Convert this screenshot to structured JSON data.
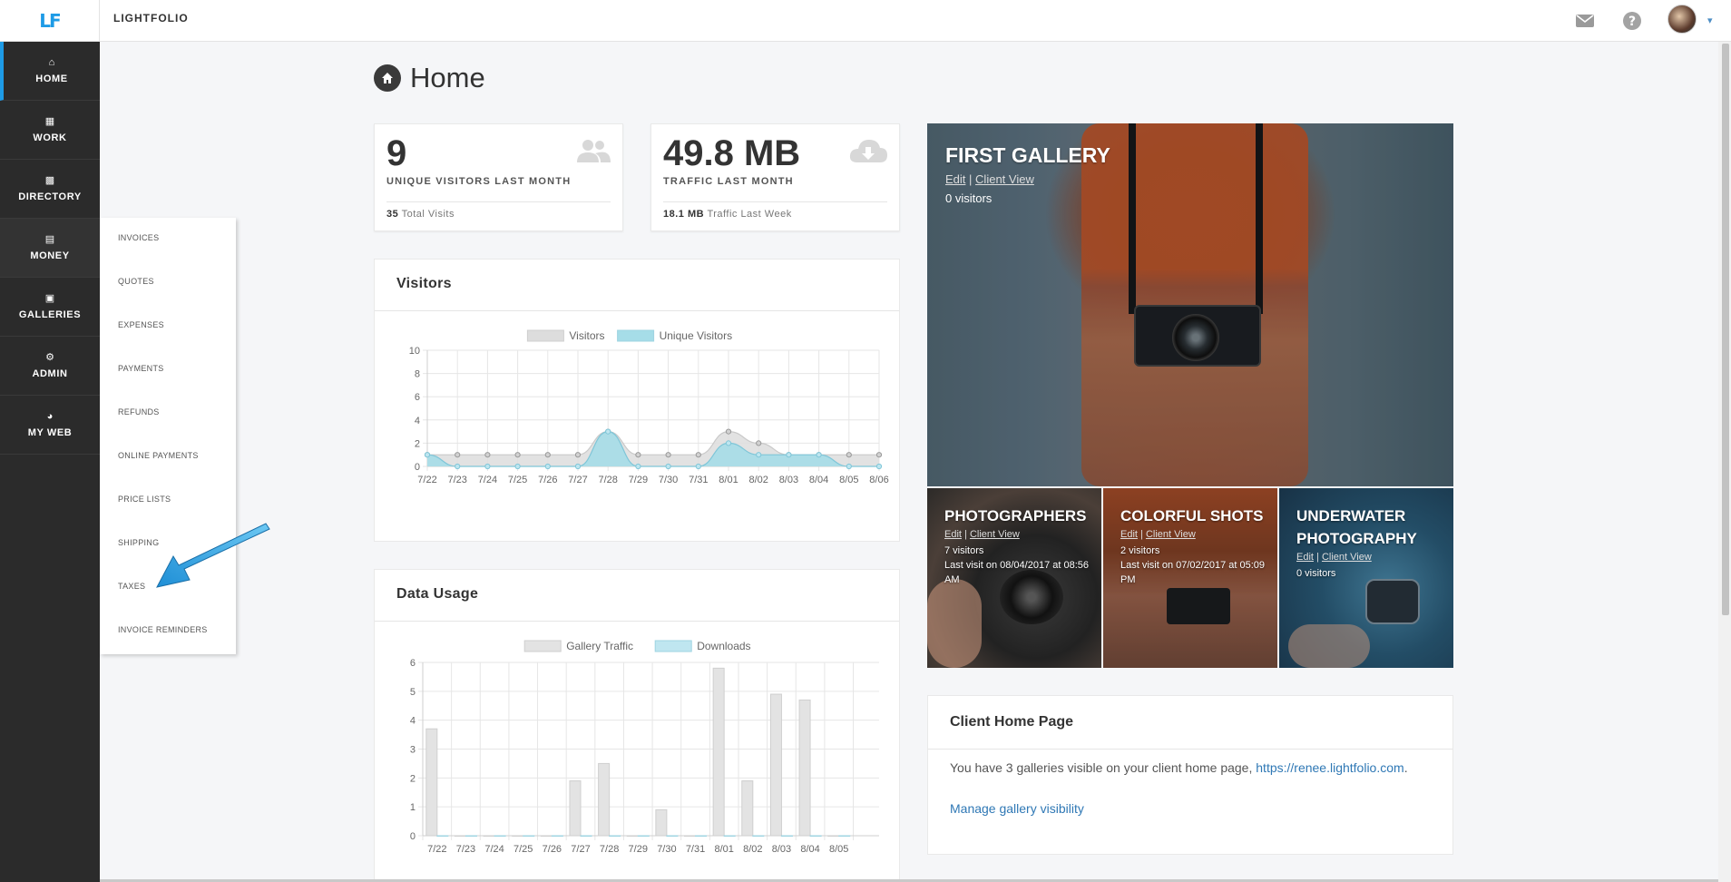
{
  "header": {
    "logo": "LF",
    "app_title": "LIGHTFOLIO",
    "icons": [
      "mail-icon",
      "help-icon",
      "avatar",
      "chevron-down-icon"
    ]
  },
  "sidebar": {
    "items": [
      {
        "label": "HOME",
        "icon": "home-icon",
        "active": true
      },
      {
        "label": "WORK",
        "icon": "calendar-icon"
      },
      {
        "label": "DIRECTORY",
        "icon": "directory-icon"
      },
      {
        "label": "MONEY",
        "icon": "money-icon"
      },
      {
        "label": "GALLERIES",
        "icon": "image-icon"
      },
      {
        "label": "ADMIN",
        "icon": "gear-icon"
      },
      {
        "label": "MY WEB",
        "icon": "globe-icon"
      }
    ]
  },
  "money_menu": {
    "items": [
      "INVOICES",
      "QUOTES",
      "EXPENSES",
      "PAYMENTS",
      "REFUNDS",
      "ONLINE PAYMENTS",
      "PRICE LISTS",
      "SHIPPING",
      "TAXES",
      "INVOICE REMINDERS"
    ]
  },
  "page": {
    "title": "Home"
  },
  "stats": [
    {
      "value": "9",
      "label": "UNIQUE VISITORS LAST MONTH",
      "foot_value": "35",
      "foot_text": "Total Visits",
      "icon": "users-icon"
    },
    {
      "value": "49.8 MB",
      "label": "TRAFFIC LAST MONTH",
      "foot_value": "18.1 MB",
      "foot_text": "Traffic Last Week",
      "icon": "cloud-download-icon"
    }
  ],
  "visitors_panel": {
    "title": "Visitors"
  },
  "data_usage_panel": {
    "title": "Data Usage"
  },
  "chart_data": [
    {
      "type": "area",
      "title": "Visitors",
      "categories": [
        "7/22",
        "7/23",
        "7/24",
        "7/25",
        "7/26",
        "7/27",
        "7/28",
        "7/29",
        "7/30",
        "7/31",
        "8/01",
        "8/02",
        "8/03",
        "8/04",
        "8/05",
        "8/06"
      ],
      "series": [
        {
          "name": "Visitors",
          "values": [
            1,
            1,
            1,
            1,
            1,
            1,
            3,
            1,
            1,
            1,
            3,
            2,
            1,
            1,
            1,
            1
          ],
          "color": "#dddddd"
        },
        {
          "name": "Unique Visitors",
          "values": [
            1,
            0,
            0,
            0,
            0,
            0,
            3,
            0,
            0,
            0,
            2,
            1,
            1,
            1,
            0,
            0
          ],
          "color": "#a6dde8"
        }
      ],
      "ylim": [
        0,
        10
      ],
      "yticks": [
        0,
        2,
        4,
        6,
        8,
        10
      ],
      "legend": "top",
      "grid": true
    },
    {
      "type": "bar",
      "title": "Data Usage",
      "categories": [
        "7/22",
        "7/23",
        "7/24",
        "7/25",
        "7/26",
        "7/27",
        "7/28",
        "7/29",
        "7/30",
        "7/31",
        "8/01",
        "8/02",
        "8/03",
        "8/04",
        "8/05"
      ],
      "series": [
        {
          "name": "Gallery Traffic",
          "values": [
            3.7,
            0,
            0,
            0,
            0,
            1.9,
            2.5,
            0,
            0.9,
            0,
            5.8,
            1.9,
            4.9,
            4.7,
            0
          ],
          "color": "#e3e3e3"
        },
        {
          "name": "Downloads",
          "values": [
            0,
            0,
            0,
            0,
            0,
            0,
            0,
            0,
            0,
            0,
            0,
            0,
            0,
            0,
            0
          ],
          "color": "#bfe6f0"
        }
      ],
      "ylim": [
        0,
        6
      ],
      "yticks": [
        0,
        1,
        2,
        3,
        4,
        5,
        6
      ],
      "legend": "top",
      "grid": true
    }
  ],
  "galleries": {
    "featured": {
      "title": "FIRST GALLERY",
      "edit": "Edit",
      "sep": "|",
      "client_view": "Client View",
      "visitors": "0 visitors"
    },
    "others": [
      {
        "title": "PHOTOGRAPHERS",
        "edit": "Edit",
        "sep": "|",
        "client_view": "Client View",
        "visitors": "7 visitors",
        "last_visit": "Last visit on 08/04/2017 at 08:56 AM"
      },
      {
        "title": "COLORFUL SHOTS",
        "edit": "Edit",
        "sep": "|",
        "client_view": "Client View",
        "visitors": "2 visitors",
        "last_visit": "Last visit on 07/02/2017 at 05:09 PM"
      },
      {
        "title": "UNDERWATER PHOTOGRAPHY",
        "edit": "Edit",
        "sep": "|",
        "client_view": "Client View",
        "visitors": "0 visitors",
        "last_visit": ""
      }
    ]
  },
  "client_home": {
    "title": "Client Home Page",
    "text": "You have 3 galleries visible on your client home page,",
    "link": "https://renee.lightfolio.com",
    "link_suffix": ".",
    "manage": "Manage gallery visibility"
  }
}
